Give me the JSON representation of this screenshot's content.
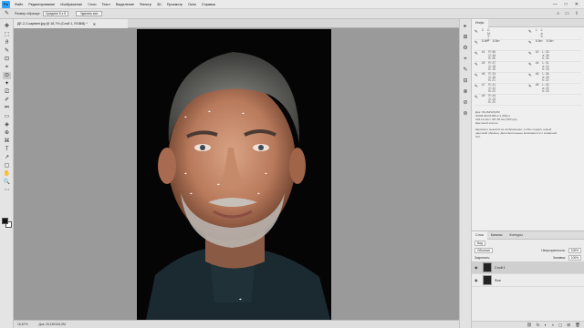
{
  "app": {
    "logo": "Ps"
  },
  "menubar": {
    "items": [
      "Файл",
      "Редактирование",
      "Изображение",
      "Слои",
      "Текст",
      "Выделение",
      "Фильтр",
      "3D",
      "Просмотр",
      "Окно",
      "Справка"
    ],
    "controls": [
      "—",
      "□",
      "✕"
    ]
  },
  "options_bar": {
    "sample_size_label": "Размер образца:",
    "sample_size_value": "Среднее 5 х 5",
    "clear_button": "Удалить все",
    "right_icons": [
      "⌕",
      "▭",
      "⇪"
    ]
  },
  "document": {
    "tab_title": "ДЕ-2-2-карвинг.jpg @ 16,7% (Слой 1, RGB/8) *",
    "close_icon": "✕"
  },
  "status": {
    "zoom": "16,67%",
    "doc_size": "Док: 26,1M/126,0M"
  },
  "toolbar": {
    "tools": [
      "✥",
      "⬚",
      "ϑ",
      "✎",
      "⊡",
      "⌖",
      "⊙",
      "✦",
      "⎚",
      "✐",
      "⎃",
      "▭",
      "◈",
      "⊕",
      "⌘",
      "T",
      "↗",
      "▢",
      "✋",
      "🔍",
      "⋯"
    ],
    "fg_color": "#111111",
    "bg_color": "#ffffff"
  },
  "dock": {
    "icons": [
      "▸",
      "⊞",
      "⚙",
      "⌖",
      "✎",
      "⊟",
      "⊗",
      "⊘",
      "⊛"
    ]
  },
  "info_panel": {
    "tab": "Инфо",
    "samples": [
      {
        "left": {
          "label": "C",
          "values": [
            "C:",
            "M:",
            "Y:",
            "K:"
          ]
        },
        "right": {
          "label": "L",
          "values": [
            "L:",
            "a:",
            "b:"
          ]
        }
      },
      {
        "left": {
          "label": "8-бит",
          "values": [
            "8-бит"
          ]
        },
        "right": {
          "label": "8-бит",
          "values": [
            "8-бит"
          ]
        }
      },
      {
        "left": {
          "label": "#1",
          "values": [
            "R:",
            "G:",
            "B:"
          ],
          "nums": [
            "56",
            "49",
            "45"
          ]
        },
        "right": {
          "label": "#2",
          "values": [
            "L:",
            "a:",
            "b:"
          ],
          "nums": [
            "33",
            "28",
            "24"
          ]
        }
      },
      {
        "left": {
          "label": "#3",
          "values": [
            "R:",
            "G:",
            "B:"
          ],
          "nums": [
            "37",
            "15",
            "15"
          ]
        },
        "right": {
          "label": "#4",
          "values": [
            "L:",
            "a:",
            "b:"
          ],
          "nums": [
            "31",
            "12",
            "15"
          ]
        }
      },
      {
        "left": {
          "label": "#5",
          "values": [
            "R:",
            "G:",
            "B:"
          ],
          "nums": [
            "33",
            "26",
            "21"
          ]
        },
        "right": {
          "label": "#6",
          "values": [
            "L:",
            "a:",
            "b:"
          ],
          "nums": [
            "36",
            "29",
            "22"
          ]
        }
      },
      {
        "left": {
          "label": "#7",
          "values": [
            "R:",
            "G:",
            "B:"
          ],
          "nums": [
            "41",
            "21",
            "20"
          ]
        },
        "right": {
          "label": "#8",
          "values": [
            "L:",
            "a:",
            "b:"
          ],
          "nums": [
            "42",
            "22",
            "20"
          ]
        }
      },
      {
        "left": {
          "label": "#9",
          "values": [
            "R:",
            "G:",
            "B:"
          ],
          "nums": [
            "44",
            "23",
            "20"
          ]
        },
        "right": {
          "label": "",
          "values": [],
          "nums": []
        }
      }
    ],
    "doc_info_lines": [
      "Док: 33,2M/126,0M",
      "sRGB IEC61966-2.1 (8bpc)",
      "222,12 мм х 467,66 мм (300 ppi)",
      "Цветовой эталон"
    ],
    "hint_lines": [
      "Щелкните мышкой на изображении, чтобы создать новый",
      "цветовой образец. Дополнительные возможности с клавишей",
      "Ctrl."
    ]
  },
  "layers_panel": {
    "tabs": [
      "Слои",
      "Каналы",
      "Контуры"
    ],
    "filter_label": "Вид",
    "blend_mode": "Обычные",
    "opacity_label": "Непрозрачность:",
    "opacity_value": "100%",
    "lock_label": "Закрепить:",
    "fill_label": "Заливка:",
    "fill_value": "100%",
    "layers": [
      {
        "name": "Слой 1",
        "selected": true
      },
      {
        "name": "Фон",
        "selected": false
      }
    ],
    "footer_icons": [
      "⛓",
      "fx",
      "◐",
      "◑",
      "▢",
      "⊞",
      "🗑"
    ]
  }
}
